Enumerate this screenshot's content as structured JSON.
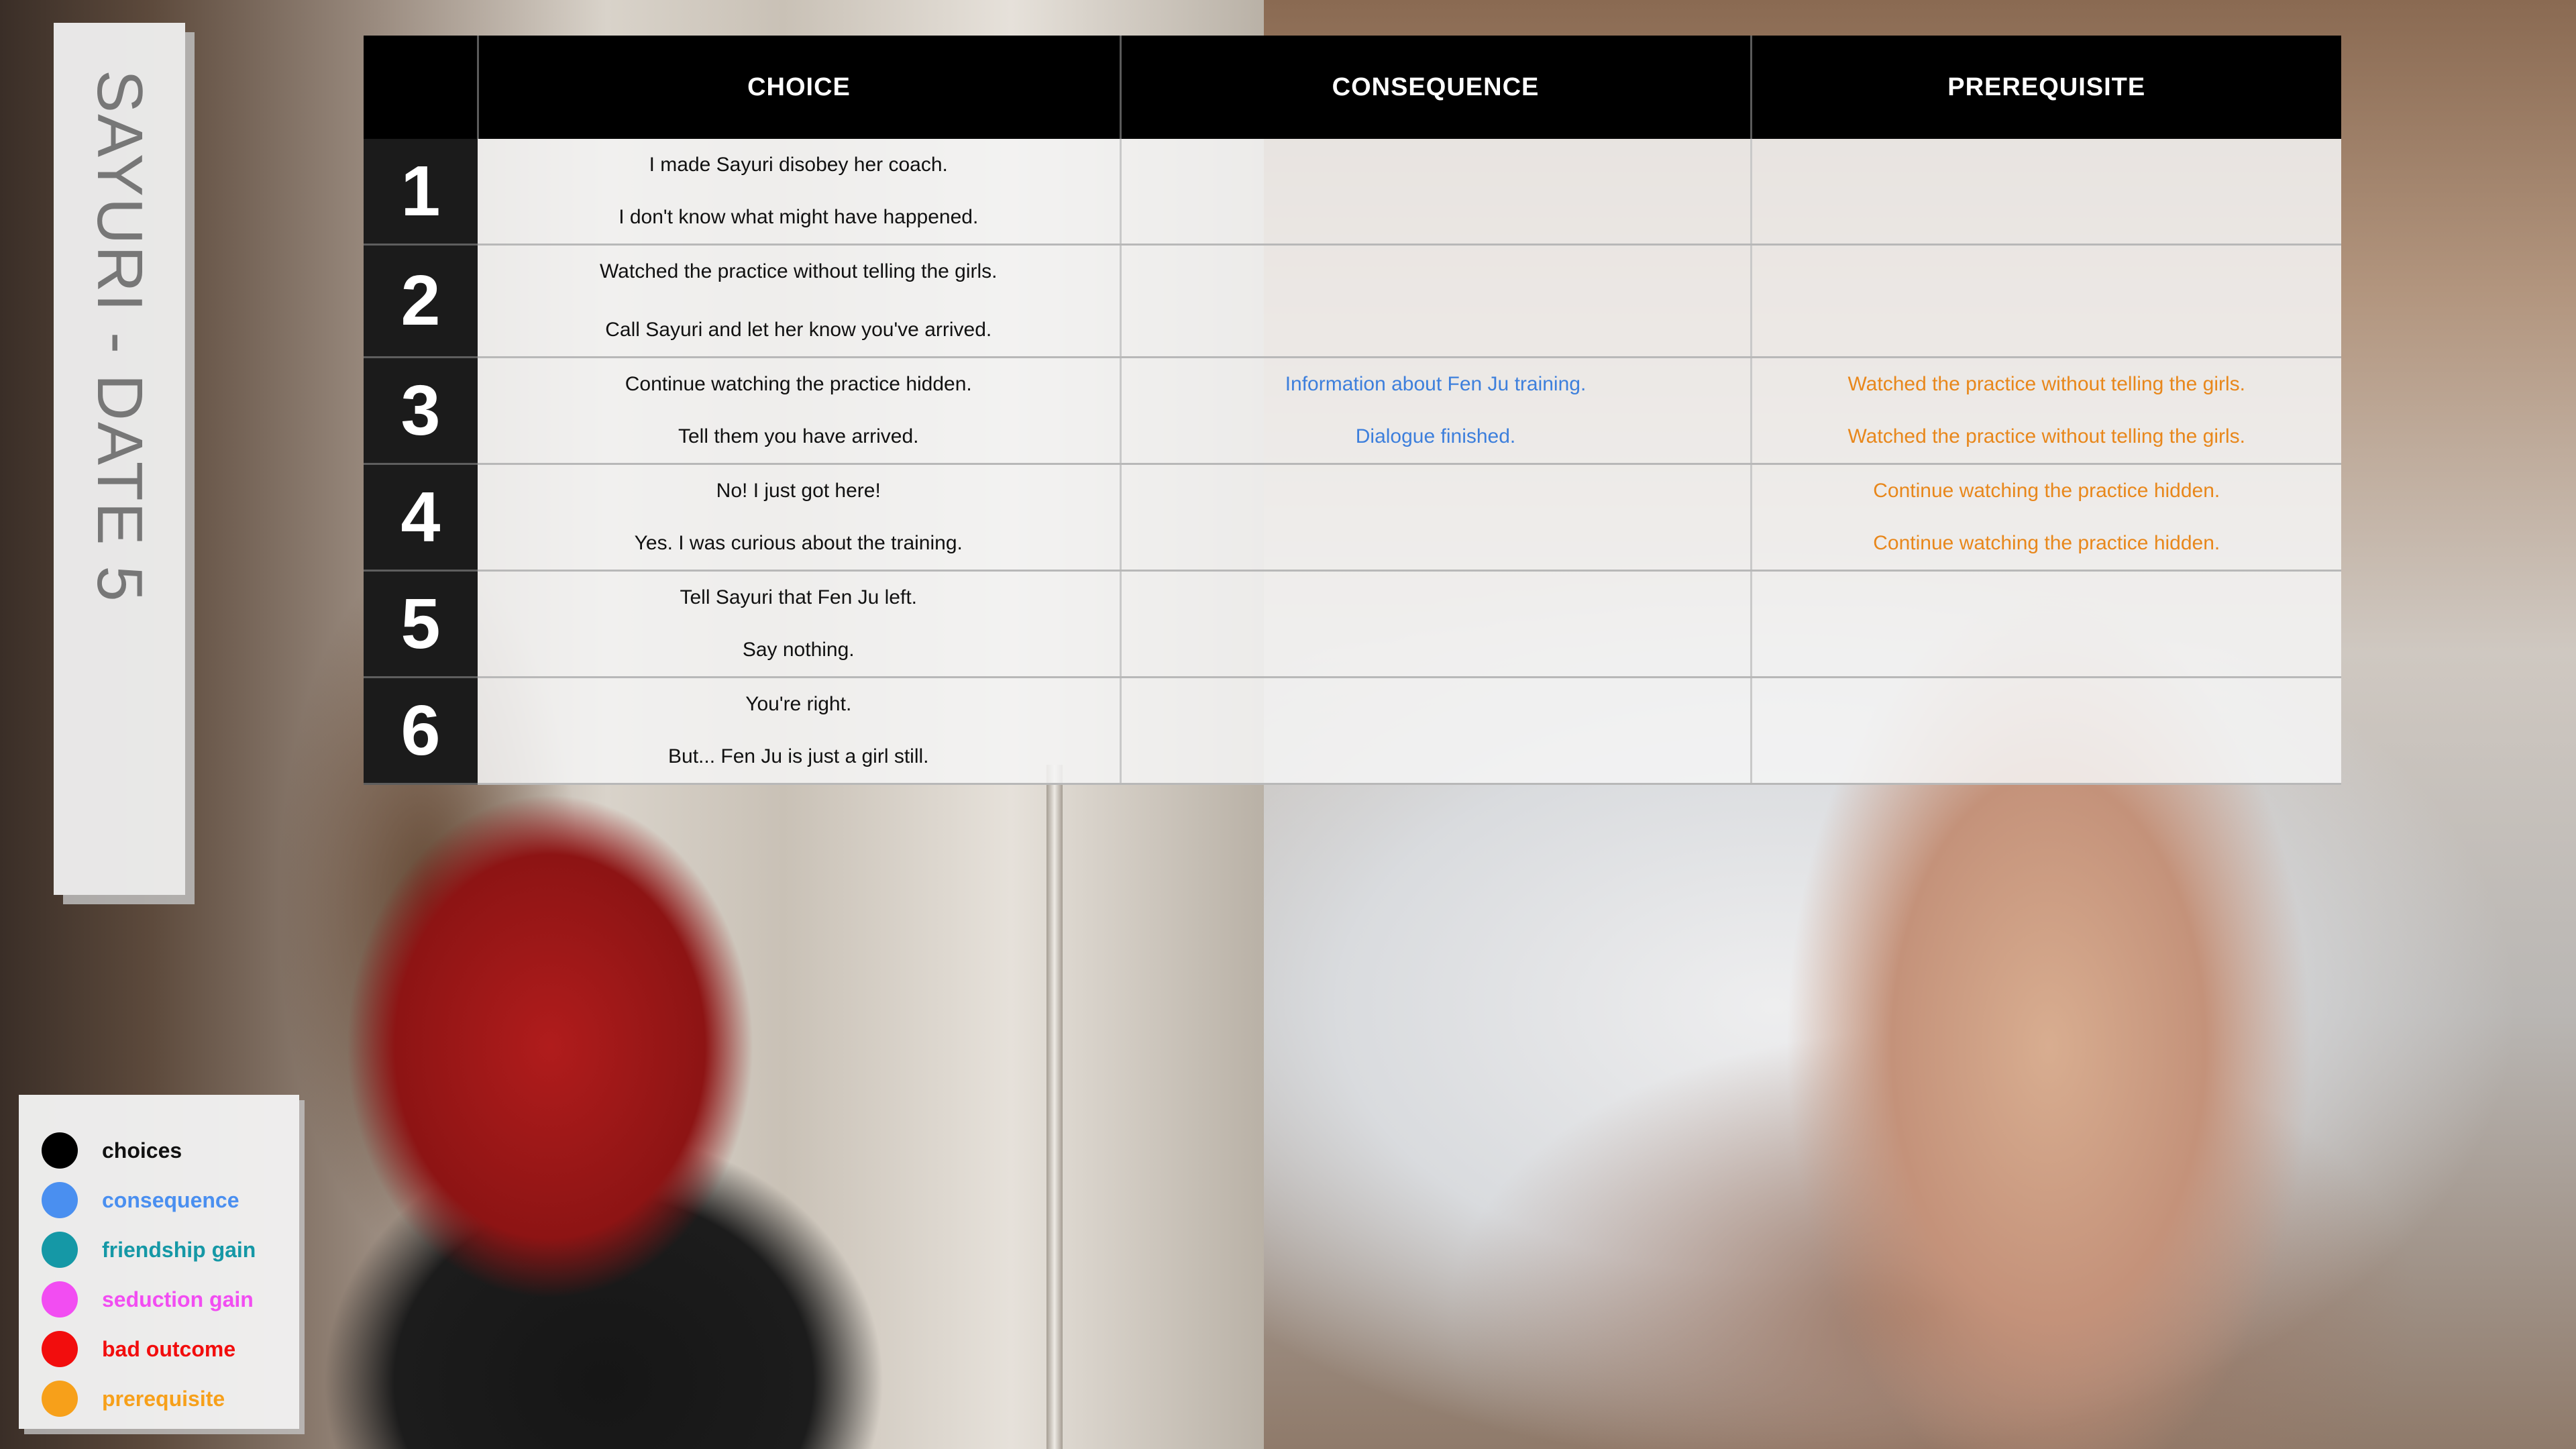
{
  "title": "SAYURI - DATE 5",
  "colors": {
    "choice": "#111111",
    "consequence": "#3d7fdc",
    "prerequisite": "#e8871b"
  },
  "table": {
    "headers": [
      "",
      "CHOICE",
      "CONSEQUENCE",
      "PREREQUISITE"
    ],
    "rows": [
      {
        "number": "1",
        "choices": [
          "I made Sayuri disobey her coach.",
          "I don't know what might have happened."
        ],
        "consequences": [
          "",
          ""
        ],
        "prerequisites": [
          "",
          ""
        ]
      },
      {
        "number": "2",
        "choices": [
          "Watched the practice without telling the girls.",
          "Call Sayuri and let her know you've arrived."
        ],
        "consequences": [
          "",
          ""
        ],
        "prerequisites": [
          "",
          ""
        ]
      },
      {
        "number": "3",
        "choices": [
          "Continue watching the practice hidden.",
          "Tell them you have arrived."
        ],
        "consequences": [
          "Information about Fen Ju training.",
          "Dialogue finished."
        ],
        "prerequisites": [
          "Watched the practice without telling the girls.",
          "Watched the practice without telling the girls."
        ]
      },
      {
        "number": "4",
        "choices": [
          "No! I just got here!",
          "Yes. I was curious about the training."
        ],
        "consequences": [
          "",
          ""
        ],
        "prerequisites": [
          "Continue watching the practice hidden.",
          "Continue watching the practice hidden."
        ]
      },
      {
        "number": "5",
        "choices": [
          "Tell Sayuri that Fen Ju left.",
          "Say nothing."
        ],
        "consequences": [
          "",
          ""
        ],
        "prerequisites": [
          "",
          ""
        ]
      },
      {
        "number": "6",
        "choices": [
          "You're right.",
          "But... Fen Ju is just a girl still."
        ],
        "consequences": [
          "",
          ""
        ],
        "prerequisites": [
          "",
          ""
        ]
      }
    ]
  },
  "legend": [
    {
      "label": "choices",
      "color": "#000000"
    },
    {
      "label": "consequence",
      "color": "#4a8ff0"
    },
    {
      "label": "friendship gain",
      "color": "#1598a6"
    },
    {
      "label": "seduction gain",
      "color": "#f24df2"
    },
    {
      "label": "bad outcome",
      "color": "#f20d0d"
    },
    {
      "label": "prerequisite",
      "color": "#f7a01a"
    }
  ]
}
